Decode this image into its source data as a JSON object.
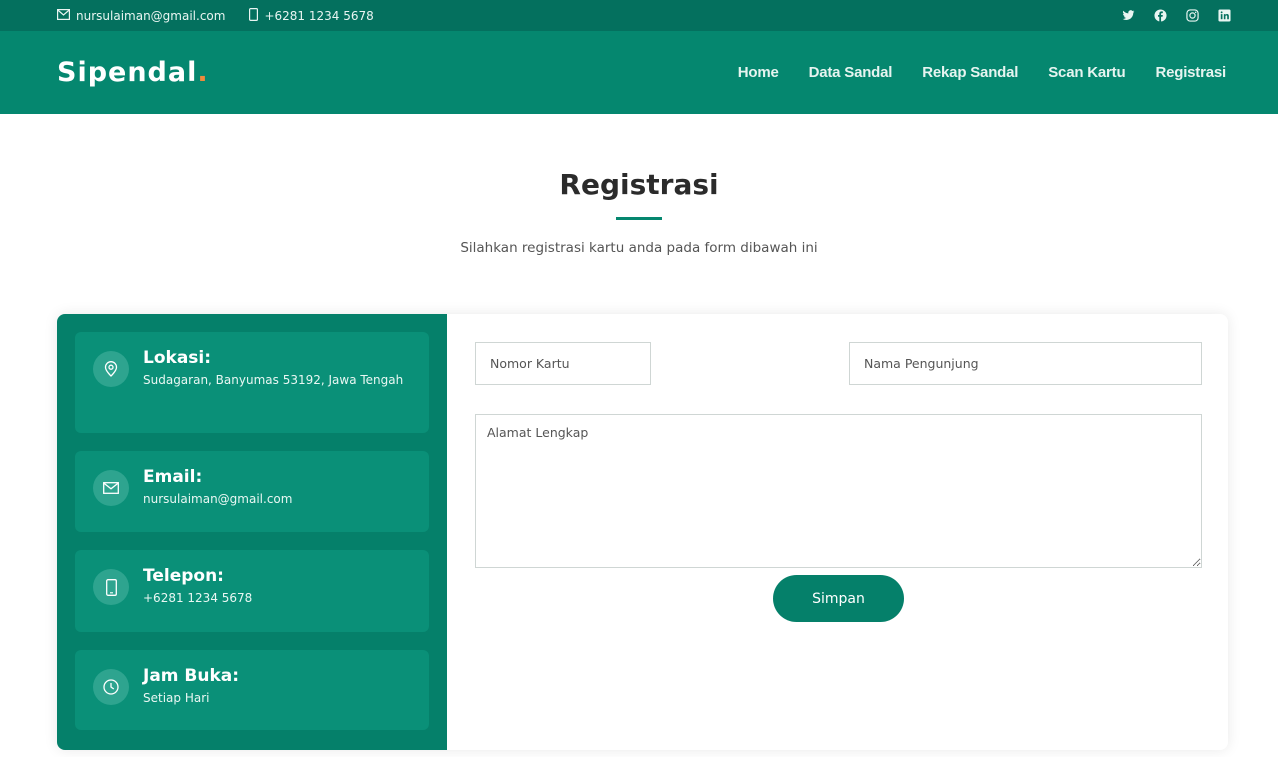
{
  "topbar": {
    "email": "nursulaiman@gmail.com",
    "phone": "+6281 1234 5678",
    "social": [
      "twitter-icon",
      "facebook-icon",
      "instagram-icon",
      "linkedin-icon"
    ]
  },
  "navbar": {
    "brand": "Sipendal",
    "brand_dot": ".",
    "links": [
      "Home",
      "Data Sandal",
      "Rekap Sandal",
      "Scan Kartu",
      "Registrasi"
    ]
  },
  "section": {
    "title": "Registrasi",
    "subtitle": "Silahkan registrasi kartu anda pada form dibawah ini"
  },
  "info": [
    {
      "icon": "map-pin-icon",
      "title": "Lokasi:",
      "text": "Sudagaran, Banyumas 53192, Jawa Tengah"
    },
    {
      "icon": "envelope-icon",
      "title": "Email:",
      "text": "nursulaiman@gmail.com"
    },
    {
      "icon": "phone-icon",
      "title": "Telepon:",
      "text": "+6281 1234 5678"
    },
    {
      "icon": "clock-icon",
      "title": "Jam Buka:",
      "text": "Setiap Hari"
    }
  ],
  "form": {
    "nomor_placeholder": "Nomor Kartu",
    "nama_placeholder": "Nama Pengunjung",
    "alamat_placeholder": "Alamat Lengkap",
    "submit_label": "Simpan"
  },
  "colors": {
    "topbar": "#04705e",
    "navbar": "#05876f",
    "accent_dot": "#f08a3c",
    "info_panel": "#05806a",
    "info_box": "#0a9078"
  }
}
